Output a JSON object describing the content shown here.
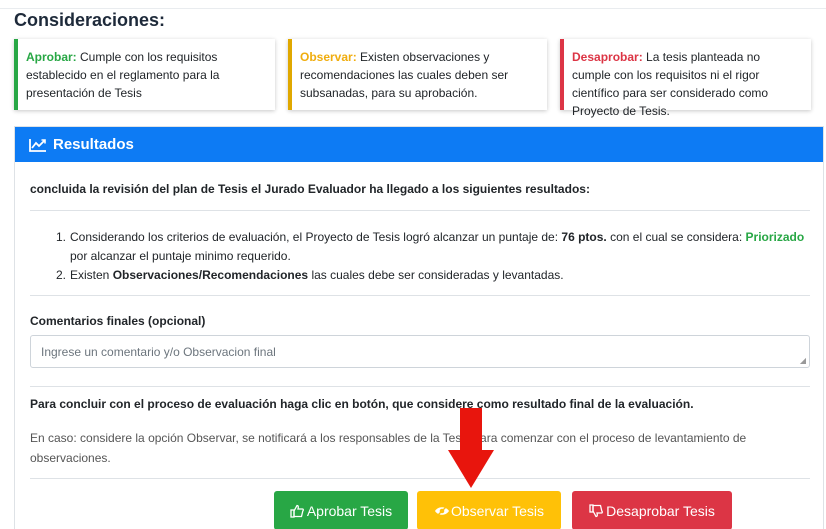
{
  "header": {
    "title": "Consideraciones:"
  },
  "cards": [
    {
      "keyword": "Aprobar:",
      "text": " Cumple con los requisitos establecido en el reglamento para la presentación de Tesis"
    },
    {
      "keyword": "Observar:",
      "text": " Existen observaciones y recomendaciones las cuales deben ser subsanadas, para su aprobación."
    },
    {
      "keyword": "Desaprobar:",
      "text": " La tesis planteada no cumple con los requisitos ni el rigor científico para ser considerado como Proyecto de Tesis."
    }
  ],
  "panel": {
    "title": "Resultados",
    "intro": "concluida la revisión del plan de Tesis el Jurado Evaluador ha llegado a los siguientes resultados:",
    "results": {
      "item1_num": "1.",
      "item1_pre": "Considerando los criterios de evaluación, el Proyecto de Tesis logró alcanzar un puntaje de: ",
      "item1_score": "76 ptos.",
      "item1_mid": " con el cual se considera: ",
      "item1_status": "Priorizado",
      "item1_post": " por alcanzar el puntaje minimo requerido.",
      "item2_num": "2.",
      "item2_pre": "Existen ",
      "item2_bold": "Observaciones/Recomendaciones",
      "item2_post": " las cuales debe ser consideradas y levantadas."
    },
    "comments_label": "Comentarios finales (opcional)",
    "comments_placeholder": "Ingrese un comentario y/o Observacion final",
    "conclude_text": "Para concluir con el proceso de evaluación haga clic en botón, que considere como resultado final de la evaluación.",
    "note_text": "En caso: considere la opción Observar, se notificará a los responsables de la Tesis para comenzar con el proceso de levantamiento de observaciones."
  },
  "buttons": {
    "approve": "Aprobar Tesis",
    "observe": "Observar Tesis",
    "disapprove": "Desaprobar Tesis"
  },
  "colors": {
    "primary": "#0d7bf4",
    "success": "#28a745",
    "warning": "#ffc107",
    "danger": "#dc3545",
    "arrow": "#e8150d"
  },
  "icons": {
    "header": "line-chart-icon",
    "approve": "thumbs-up-icon",
    "observe": "eye-slash-icon",
    "disapprove": "thumbs-down-icon",
    "pointer": "red-arrow-icon"
  }
}
